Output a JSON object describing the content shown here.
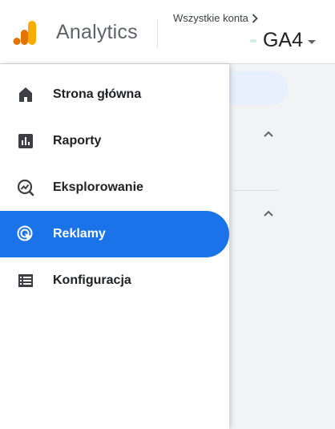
{
  "header": {
    "app_name": "Analytics",
    "account_link": "Wszystkie konta",
    "property_name": "GA4"
  },
  "sidebar": {
    "items": [
      {
        "label": "Strona główna",
        "icon": "home-icon",
        "active": false
      },
      {
        "label": "Raporty",
        "icon": "reports-icon",
        "active": false
      },
      {
        "label": "Eksplorowanie",
        "icon": "explore-icon",
        "active": false
      },
      {
        "label": "Reklamy",
        "icon": "advertising-icon",
        "active": true
      },
      {
        "label": "Konfiguracja",
        "icon": "configure-icon",
        "active": false
      }
    ]
  },
  "colors": {
    "accent": "#1a73e8",
    "logo_dark": "#e37400",
    "logo_light": "#f9ab00",
    "text": "#202124",
    "muted": "#5f6368"
  }
}
